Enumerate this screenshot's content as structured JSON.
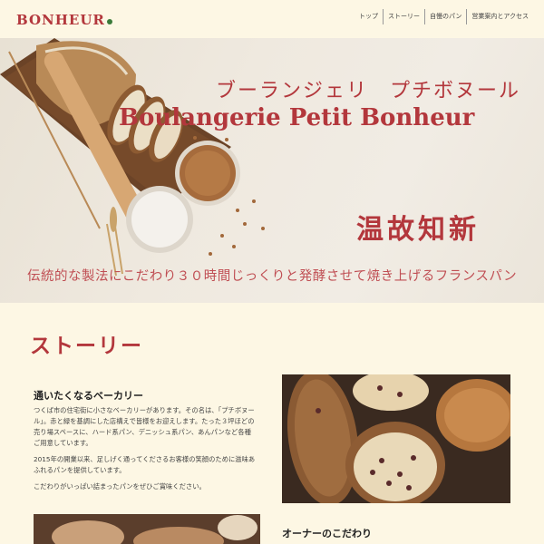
{
  "header": {
    "logo_text": "BONHEUR",
    "nav": [
      "トップ",
      "ストーリー",
      "自慢のパン",
      "営業案内とアクセス"
    ]
  },
  "hero": {
    "title_jp": "ブーランジェリ　プチボヌール",
    "title_en": "Boulangerie Petit Bonheur",
    "stamp": "温故知新",
    "tagline": "伝統的な製法にこだわり３０時間じっくりと発酵させて焼き上げるフランスパン"
  },
  "story": {
    "heading": "ストーリー",
    "card_title": "通いたくなるベーカリー",
    "paragraphs": [
      "つくば市の住宅街に小さなベーカリーがあります。その名は、「プチボヌール」。赤と緑を基調にした店構えで皆様をお迎えします。たった３坪ほどの売り場スペースに、ハード系パン、デニッシュ系パン、あんパンなど各種ご用意しています。",
      "2015年の開業以来、足しげく通ってくださるお客様の笑顔のために滋味あふれるパンを提供しています。",
      "こだわりがいっぱい詰まったパンをぜひご賞味ください。"
    ],
    "owner_title": "オーナーのこだわり"
  },
  "colors": {
    "brand_red": "#b3373c",
    "logo_green": "#3b7a3a",
    "background": "#fdf7e4"
  }
}
